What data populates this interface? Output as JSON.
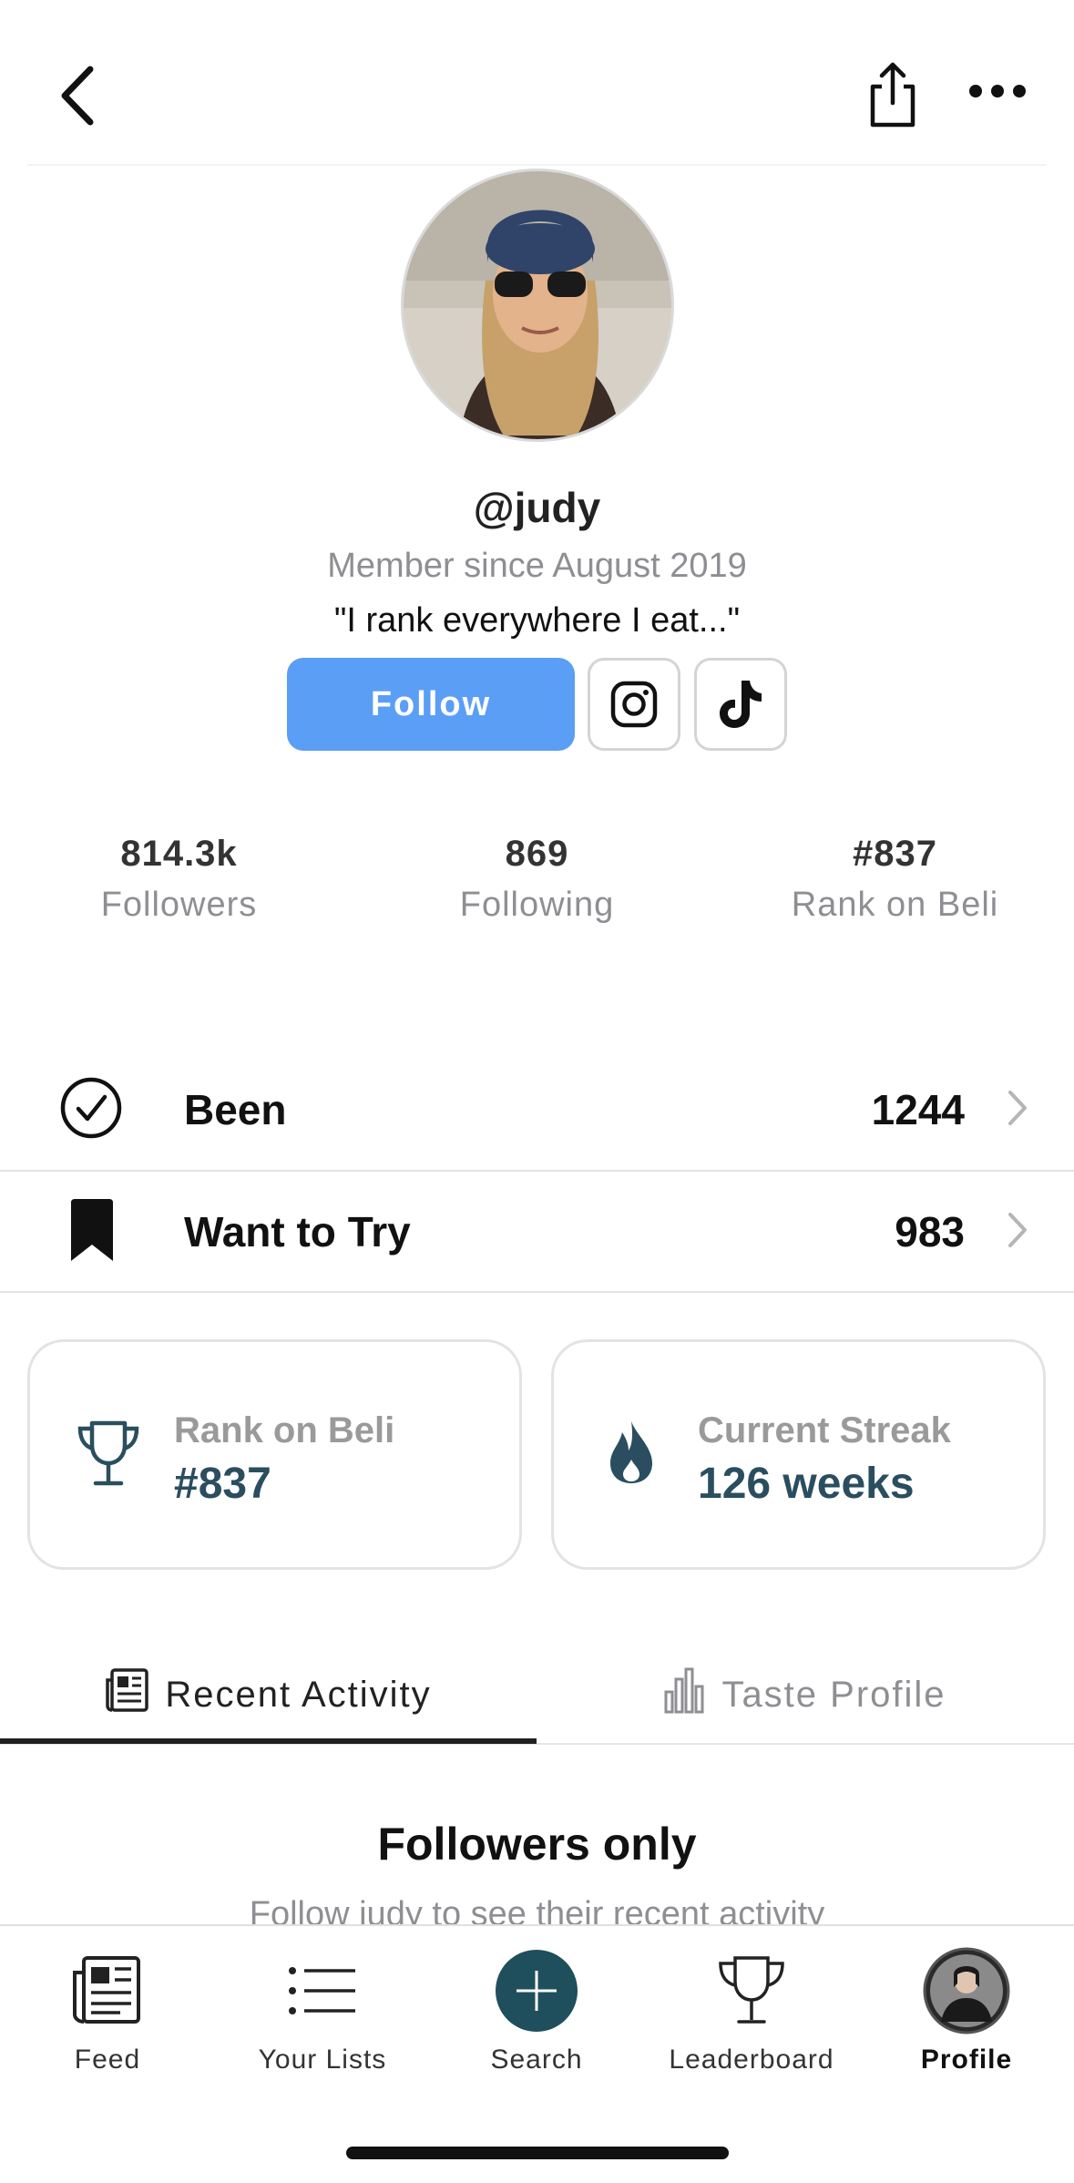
{
  "header": {
    "back_icon": "chevron-left-icon",
    "share_icon": "share-icon",
    "more_icon": "more-horizontal-icon"
  },
  "profile": {
    "handle": "@judy",
    "member_since": "Member since August 2019",
    "bio": "\"I rank everywhere I eat...\"",
    "follow_label": "Follow",
    "accent_color": "#5b9ef5"
  },
  "stats": [
    {
      "value": "814.3k",
      "label": "Followers"
    },
    {
      "value": "869",
      "label": "Following"
    },
    {
      "value": "#837",
      "label": "Rank on Beli"
    }
  ],
  "lists": [
    {
      "label": "Been",
      "count": "1244",
      "icon": "check-circle-icon"
    },
    {
      "label": "Want to Try",
      "count": "983",
      "icon": "bookmark-icon"
    }
  ],
  "cards": [
    {
      "label": "Rank on Beli",
      "value": "#837",
      "icon": "trophy-icon"
    },
    {
      "label": "Current Streak",
      "value": "126 weeks",
      "icon": "flame-icon"
    }
  ],
  "tabs": [
    {
      "label": "Recent Activity",
      "active": true,
      "icon": "newspaper-icon"
    },
    {
      "label": "Taste Profile",
      "active": false,
      "icon": "bar-chart-icon"
    }
  ],
  "followers_only": {
    "title": "Followers only",
    "subtitle": "Follow judy to see their recent activity"
  },
  "tabbar": [
    {
      "label": "Feed",
      "icon": "newspaper-icon"
    },
    {
      "label": "Your Lists",
      "icon": "list-icon"
    },
    {
      "label": "Search",
      "icon": "plus-circle-icon"
    },
    {
      "label": "Leaderboard",
      "icon": "trophy-icon"
    },
    {
      "label": "Profile",
      "icon": "avatar",
      "active": true
    }
  ]
}
